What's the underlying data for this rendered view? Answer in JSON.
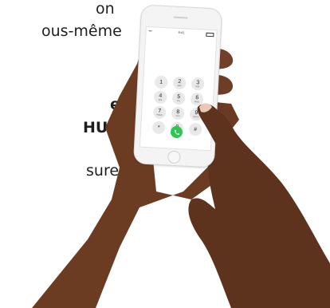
{
  "text_lines": [
    {
      "text": "on",
      "bold": false
    },
    {
      "text": "ous-même",
      "bold": false
    },
    {
      "text": "ert",
      "bold": true
    },
    {
      "text": "HUM.",
      "bold": true
    },
    {
      "text": "surez-",
      "bold": false
    }
  ],
  "phone": {
    "status_time": "9:41",
    "keys": [
      {
        "digit": "1",
        "letters": ""
      },
      {
        "digit": "2",
        "letters": "ABC"
      },
      {
        "digit": "3",
        "letters": "DEF"
      },
      {
        "digit": "4",
        "letters": "GHI"
      },
      {
        "digit": "5",
        "letters": "JKL"
      },
      {
        "digit": "6",
        "letters": "MNO"
      },
      {
        "digit": "7",
        "letters": "PQRS"
      },
      {
        "digit": "8",
        "letters": "TUV"
      },
      {
        "digit": "9",
        "letters": "WXYZ"
      },
      {
        "digit": "*",
        "letters": ""
      },
      {
        "digit": "0",
        "letters": "+"
      },
      {
        "digit": "#",
        "letters": ""
      }
    ]
  },
  "colors": {
    "call_green": "#2dc653",
    "skin": "#6b3c22",
    "text": "#1e1e1e"
  }
}
